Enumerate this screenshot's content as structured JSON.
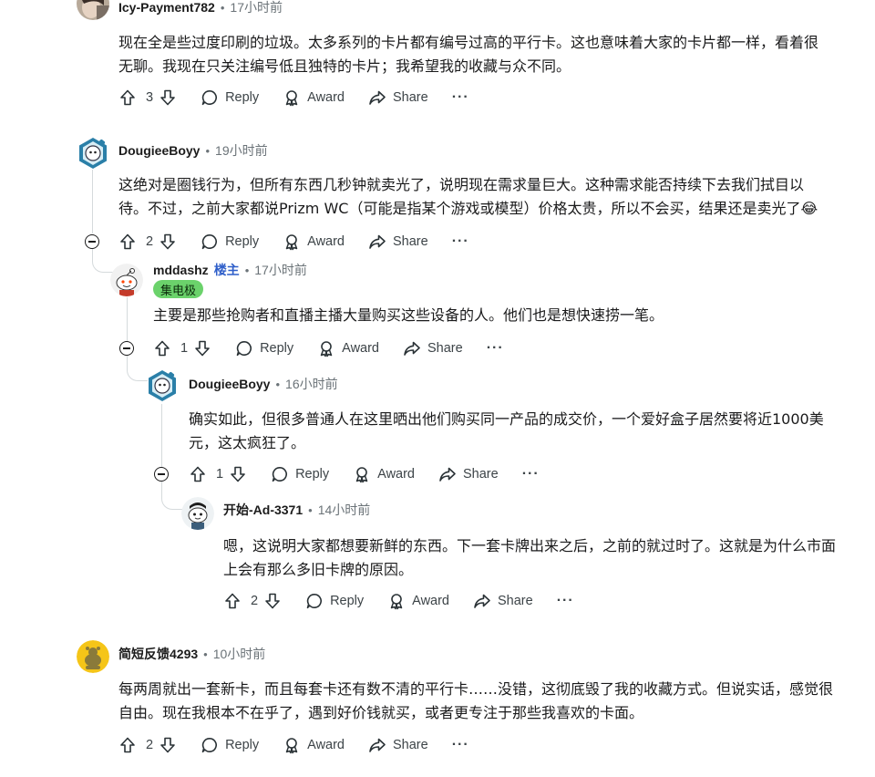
{
  "actions": {
    "reply": "Reply",
    "award": "Award",
    "share": "Share",
    "more": "···"
  },
  "comments": [
    {
      "user": "Icy-Payment782",
      "time": "17小时前",
      "lines": [
        "现在全是些过度印刷的垃圾。太多系列的卡片都有编号过高的平行卡。这也意味着大家的卡片都一样，看着很",
        "无聊。我现在只关注编号低且独特的卡片；我希望我的收藏与众不同。"
      ],
      "votes": "3"
    },
    {
      "user": "DougieeBoyy",
      "time": "19小时前",
      "lines": [
        "这绝对是圈钱行为，但所有东西几秒钟就卖光了，说明现在需求量巨大。这种需求能否持续下去我们拭目以",
        "待。不过，之前大家都说Prizm WC（可能是指某个游戏或模型）价格太贵，所以不会买，结果还是卖光了😂"
      ],
      "votes": "2"
    },
    {
      "user": "mddashz",
      "op_label": "楼主",
      "time": "17小时前",
      "flair": "集电极",
      "lines": [
        "主要是那些抢购者和直播主播大量购买这些设备的人。他们也是想快速捞一笔。"
      ],
      "votes": "1"
    },
    {
      "user": "DougieeBoyy",
      "time": "16小时前",
      "lines": [
        "确实如此，但很多普通人在这里晒出他们购买同一产品的成交价，一个爱好盒子居然要将近1000美",
        "元，这太疯狂了。"
      ],
      "votes": "1"
    },
    {
      "user": "开始-Ad-3371",
      "time": "14小时前",
      "lines": [
        "嗯，这说明大家都想要新鲜的东西。下一套卡牌出来之后，之前的就过时了。这就是为什么市面",
        "上会有那么多旧卡牌的原因。"
      ],
      "votes": "2"
    },
    {
      "user": "简短反馈4293",
      "time": "10小时前",
      "lines": [
        "每两周就出一套新卡，而且每套卡还有数不清的平行卡……没错，这彻底毁了我的收藏方式。但说实话，感觉很",
        "自由。现在我根本不在乎了，遇到好价钱就买，或者更专注于那些我喜欢的卡面。"
      ],
      "votes": "2"
    }
  ],
  "dot": "•"
}
